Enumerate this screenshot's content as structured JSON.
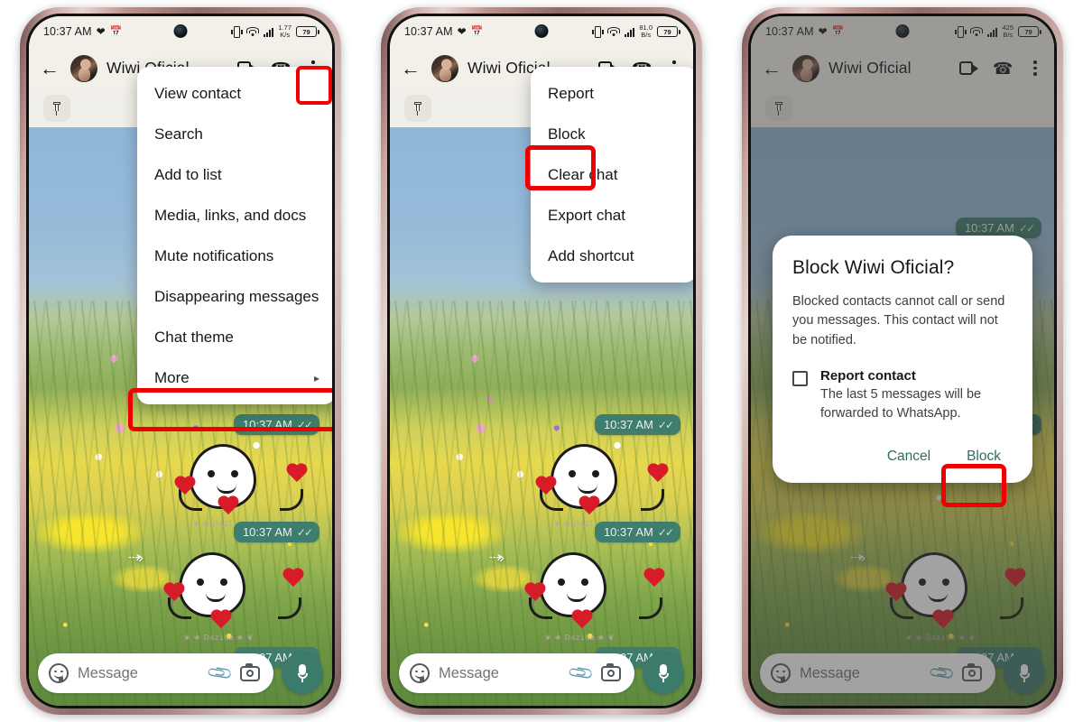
{
  "app": {
    "name": "WhatsApp",
    "contact_name": "Wiwi Oficial"
  },
  "status_bar": {
    "time": "10:37 AM",
    "left_icons": [
      "heart-icon",
      "calendar-icon"
    ],
    "right_icons": [
      "vibrate-icon",
      "wifi-icon",
      "signal-icon"
    ],
    "battery_percent": "79",
    "net_speed_1_value": "1.77",
    "net_speed_1_unit": "K/s",
    "net_speed_2_value": "81.0",
    "net_speed_2_unit": "B/s",
    "net_speed_3_value": "425",
    "net_speed_3_unit": "B/s"
  },
  "app_bar": {
    "back_icon": "back-arrow-icon",
    "avatar": "contact-avatar",
    "title": "Wiwi Oficial",
    "video_call_icon": "video-call-icon",
    "voice_call_icon": "phone-call-icon",
    "overflow_icon": "three-dots-menu-icon"
  },
  "pinned_bar": {
    "pin_icon": "pushpin-icon"
  },
  "messages": {
    "timestamp": "10:37 AM",
    "ticks": "✓✓",
    "sticker_watermark": "❦ ❀ Daz16a ❀ ❦",
    "forward_icon": "forwarded-arrow-icon"
  },
  "composer": {
    "emoji_icon": "emoji-icon",
    "placeholder": "Message",
    "attach_icon": "paperclip-icon",
    "camera_icon": "camera-icon",
    "mic_icon": "microphone-icon"
  },
  "panel1": {
    "menu_items": [
      {
        "label": "View contact",
        "has_submenu": false,
        "highlighted": false
      },
      {
        "label": "Search",
        "has_submenu": false,
        "highlighted": false
      },
      {
        "label": "Add to list",
        "has_submenu": false,
        "highlighted": false
      },
      {
        "label": "Media, links, and docs",
        "has_submenu": false,
        "highlighted": false
      },
      {
        "label": "Mute notifications",
        "has_submenu": false,
        "highlighted": false
      },
      {
        "label": "Disappearing messages",
        "has_submenu": false,
        "highlighted": false
      },
      {
        "label": "Chat theme",
        "has_submenu": false,
        "highlighted": false
      },
      {
        "label": "More",
        "has_submenu": true,
        "highlighted": true
      }
    ],
    "submenu_arrow": "▸",
    "highlight_overflow_button": true
  },
  "panel2": {
    "menu_items": [
      {
        "label": "Report",
        "highlighted": false
      },
      {
        "label": "Block",
        "highlighted": true
      },
      {
        "label": "Clear chat",
        "highlighted": false
      },
      {
        "label": "Export chat",
        "highlighted": false
      },
      {
        "label": "Add shortcut",
        "highlighted": false
      }
    ]
  },
  "panel3": {
    "dialog": {
      "title": "Block Wiwi Oficial?",
      "body": "Blocked contacts cannot call or send you messages. This contact will not be notified.",
      "checkbox_label": "Report contact",
      "checkbox_sub": "The last 5 messages will be forwarded to WhatsApp.",
      "checkbox_checked": false,
      "cancel_label": "Cancel",
      "confirm_label": "Block",
      "confirm_highlighted": true
    }
  },
  "colors": {
    "highlight_red": "#ee0000",
    "whatsapp_teal": "#3c7a6b",
    "bubble_green": "#3f7d6e",
    "dialog_action_teal": "#2d6e62",
    "app_bar_bg": "#f3f0ea"
  }
}
